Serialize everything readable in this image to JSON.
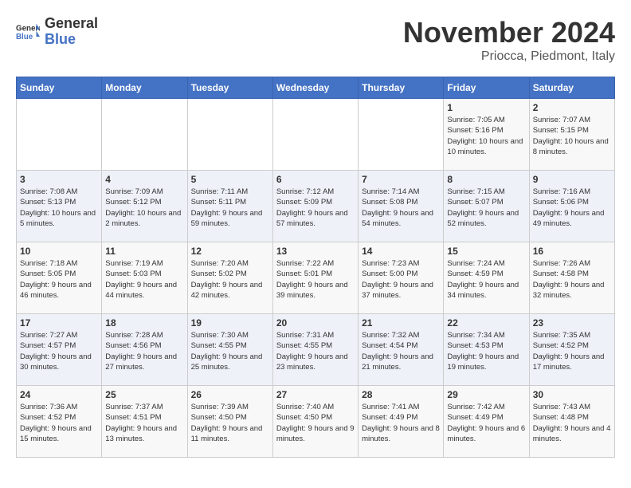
{
  "header": {
    "logo_general": "General",
    "logo_blue": "Blue",
    "month": "November 2024",
    "location": "Priocca, Piedmont, Italy"
  },
  "weekdays": [
    "Sunday",
    "Monday",
    "Tuesday",
    "Wednesday",
    "Thursday",
    "Friday",
    "Saturday"
  ],
  "weeks": [
    [
      {
        "day": "",
        "info": ""
      },
      {
        "day": "",
        "info": ""
      },
      {
        "day": "",
        "info": ""
      },
      {
        "day": "",
        "info": ""
      },
      {
        "day": "",
        "info": ""
      },
      {
        "day": "1",
        "info": "Sunrise: 7:05 AM\nSunset: 5:16 PM\nDaylight: 10 hours and 10 minutes."
      },
      {
        "day": "2",
        "info": "Sunrise: 7:07 AM\nSunset: 5:15 PM\nDaylight: 10 hours and 8 minutes."
      }
    ],
    [
      {
        "day": "3",
        "info": "Sunrise: 7:08 AM\nSunset: 5:13 PM\nDaylight: 10 hours and 5 minutes."
      },
      {
        "day": "4",
        "info": "Sunrise: 7:09 AM\nSunset: 5:12 PM\nDaylight: 10 hours and 2 minutes."
      },
      {
        "day": "5",
        "info": "Sunrise: 7:11 AM\nSunset: 5:11 PM\nDaylight: 9 hours and 59 minutes."
      },
      {
        "day": "6",
        "info": "Sunrise: 7:12 AM\nSunset: 5:09 PM\nDaylight: 9 hours and 57 minutes."
      },
      {
        "day": "7",
        "info": "Sunrise: 7:14 AM\nSunset: 5:08 PM\nDaylight: 9 hours and 54 minutes."
      },
      {
        "day": "8",
        "info": "Sunrise: 7:15 AM\nSunset: 5:07 PM\nDaylight: 9 hours and 52 minutes."
      },
      {
        "day": "9",
        "info": "Sunrise: 7:16 AM\nSunset: 5:06 PM\nDaylight: 9 hours and 49 minutes."
      }
    ],
    [
      {
        "day": "10",
        "info": "Sunrise: 7:18 AM\nSunset: 5:05 PM\nDaylight: 9 hours and 46 minutes."
      },
      {
        "day": "11",
        "info": "Sunrise: 7:19 AM\nSunset: 5:03 PM\nDaylight: 9 hours and 44 minutes."
      },
      {
        "day": "12",
        "info": "Sunrise: 7:20 AM\nSunset: 5:02 PM\nDaylight: 9 hours and 42 minutes."
      },
      {
        "day": "13",
        "info": "Sunrise: 7:22 AM\nSunset: 5:01 PM\nDaylight: 9 hours and 39 minutes."
      },
      {
        "day": "14",
        "info": "Sunrise: 7:23 AM\nSunset: 5:00 PM\nDaylight: 9 hours and 37 minutes."
      },
      {
        "day": "15",
        "info": "Sunrise: 7:24 AM\nSunset: 4:59 PM\nDaylight: 9 hours and 34 minutes."
      },
      {
        "day": "16",
        "info": "Sunrise: 7:26 AM\nSunset: 4:58 PM\nDaylight: 9 hours and 32 minutes."
      }
    ],
    [
      {
        "day": "17",
        "info": "Sunrise: 7:27 AM\nSunset: 4:57 PM\nDaylight: 9 hours and 30 minutes."
      },
      {
        "day": "18",
        "info": "Sunrise: 7:28 AM\nSunset: 4:56 PM\nDaylight: 9 hours and 27 minutes."
      },
      {
        "day": "19",
        "info": "Sunrise: 7:30 AM\nSunset: 4:55 PM\nDaylight: 9 hours and 25 minutes."
      },
      {
        "day": "20",
        "info": "Sunrise: 7:31 AM\nSunset: 4:55 PM\nDaylight: 9 hours and 23 minutes."
      },
      {
        "day": "21",
        "info": "Sunrise: 7:32 AM\nSunset: 4:54 PM\nDaylight: 9 hours and 21 minutes."
      },
      {
        "day": "22",
        "info": "Sunrise: 7:34 AM\nSunset: 4:53 PM\nDaylight: 9 hours and 19 minutes."
      },
      {
        "day": "23",
        "info": "Sunrise: 7:35 AM\nSunset: 4:52 PM\nDaylight: 9 hours and 17 minutes."
      }
    ],
    [
      {
        "day": "24",
        "info": "Sunrise: 7:36 AM\nSunset: 4:52 PM\nDaylight: 9 hours and 15 minutes."
      },
      {
        "day": "25",
        "info": "Sunrise: 7:37 AM\nSunset: 4:51 PM\nDaylight: 9 hours and 13 minutes."
      },
      {
        "day": "26",
        "info": "Sunrise: 7:39 AM\nSunset: 4:50 PM\nDaylight: 9 hours and 11 minutes."
      },
      {
        "day": "27",
        "info": "Sunrise: 7:40 AM\nSunset: 4:50 PM\nDaylight: 9 hours and 9 minutes."
      },
      {
        "day": "28",
        "info": "Sunrise: 7:41 AM\nSunset: 4:49 PM\nDaylight: 9 hours and 8 minutes."
      },
      {
        "day": "29",
        "info": "Sunrise: 7:42 AM\nSunset: 4:49 PM\nDaylight: 9 hours and 6 minutes."
      },
      {
        "day": "30",
        "info": "Sunrise: 7:43 AM\nSunset: 4:48 PM\nDaylight: 9 hours and 4 minutes."
      }
    ]
  ]
}
